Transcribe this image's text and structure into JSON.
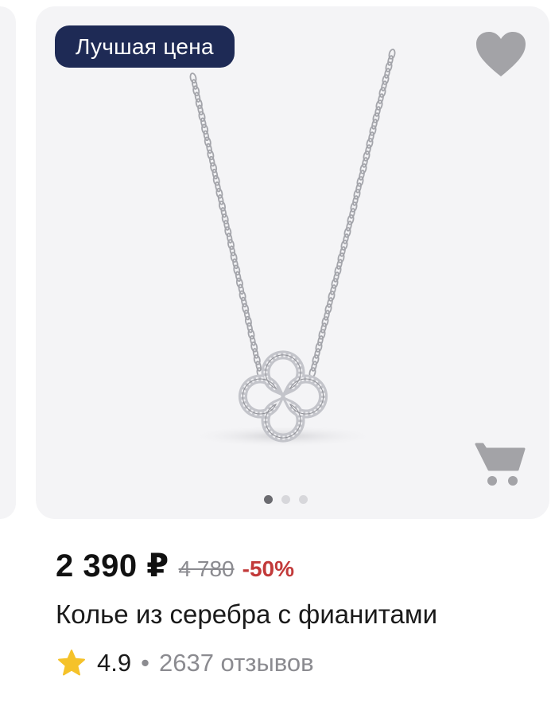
{
  "product": {
    "badge": "Лучшая цена",
    "price": "2 390 ₽",
    "old_price": "4 780",
    "discount": "-50%",
    "title": "Колье из серебра с фианитами",
    "rating": "4.9",
    "separator": "•",
    "reviews": "2637 отзывов",
    "gallery": {
      "images_count": 3,
      "active_index": 0
    }
  },
  "icons": {
    "favorite": "heart-icon",
    "cart": "cart-icon",
    "rating": "star-icon"
  },
  "colors": {
    "badge_bg": "#1e2a55",
    "discount": "#c23a3a",
    "star": "#f5c22a",
    "icon_gray": "#a3a3a7",
    "card_bg": "#f4f4f6"
  }
}
